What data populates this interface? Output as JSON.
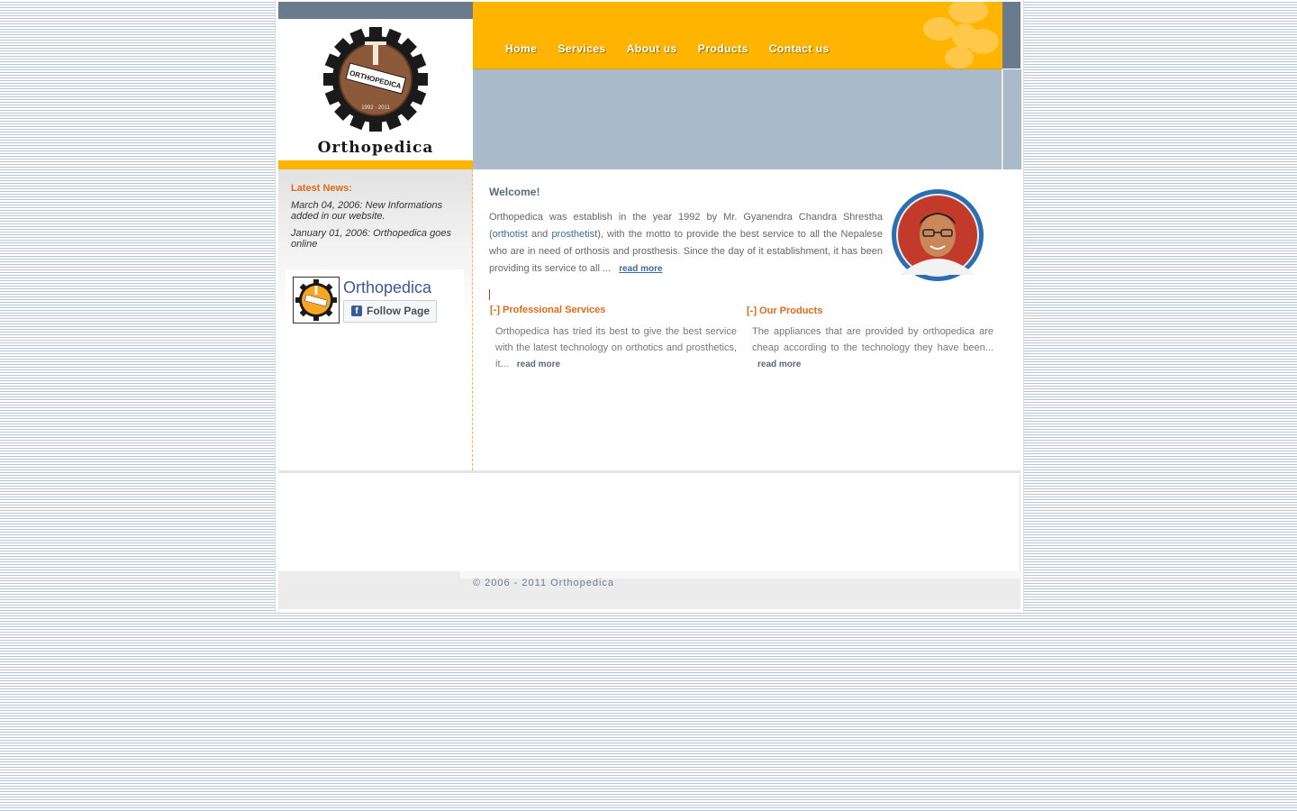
{
  "header": {
    "logo_text": "Orthopedica",
    "nav": [
      "Home",
      "Services",
      "About us",
      "Products",
      "Contact us"
    ],
    "accent_color": "#ffb400",
    "banner_color": "#a9bbcb"
  },
  "sidebar": {
    "news_title": "Latest News:",
    "news": [
      "March 04, 2006: New Informations added in our website.",
      "January 01, 2006: Orthopedica goes online"
    ],
    "facebook": {
      "page_name": "Orthopedica",
      "follow_label": "Follow Page",
      "icon": "facebook-icon"
    }
  },
  "main": {
    "welcome": "Welcome!",
    "intro_before": "Orthopedica was establish in the year 1992 by Mr. Gyanendra Chandra Shrestha (",
    "link_orthotist": "orthotist",
    "intro_and": " and ",
    "link_prosthetist": "prosthetist",
    "intro_after": "), with the motto to provide the best service to all the Nepalese who are in need of orthosis and prosthesis. Since the day of it establishment, it has been providing its service to all ...",
    "read_more": "read more",
    "services": {
      "title": "[-] Professional Services",
      "text": "Orthopedica has tried its best to give the best service with the latest technology on orthotics and prosthetics, it...",
      "read_more": "read more"
    },
    "products": {
      "title": "[-] Our Products",
      "text": "The appliances that are provided by orthopedica are cheap according to the technology they have been...",
      "read_more": "read more"
    }
  },
  "footer": {
    "copyright": "© 2006 - 2011 Orthopedica"
  }
}
